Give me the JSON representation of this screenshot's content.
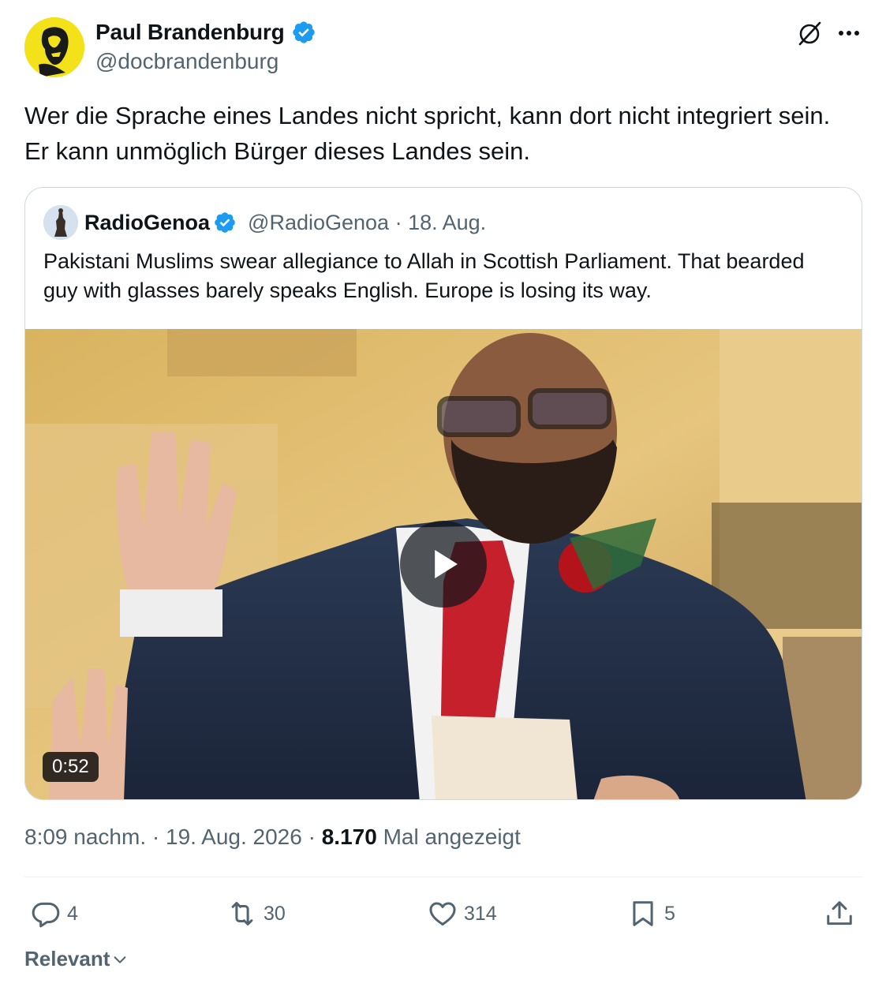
{
  "author": {
    "name": "Paul Brandenburg",
    "handle": "@docbrandenburg",
    "verified": true
  },
  "tweet": {
    "text": "Wer die Sprache eines Landes nicht spricht, kann dort nicht integriert sein. Er kann unmöglich Bürger dieses Landes sein."
  },
  "quoted": {
    "name": "RadioGenoa",
    "handle": "@RadioGenoa",
    "date_sep": " · ",
    "date": "18. Aug.",
    "text": "Pakistani Muslims swear allegiance to Allah in Scottish Parliament. That bearded guy with glasses barely speaks English. Europe is losing its way.",
    "video": {
      "duration": "0:52"
    }
  },
  "meta": {
    "time": "8:09 nachm.",
    "sep1": " · ",
    "date": "19. Aug. 2026",
    "sep2": " · ",
    "views": "8.170",
    "views_label": " Mal angezeigt"
  },
  "actions": {
    "replies": "4",
    "reposts": "30",
    "likes": "314",
    "bookmarks": "5"
  },
  "sort": {
    "label": "Relevant"
  },
  "icons": {
    "verified": "verified-badge-icon",
    "grok": "grok-icon",
    "more": "more-icon",
    "play": "play-icon",
    "reply": "reply-icon",
    "repost": "repost-icon",
    "like": "heart-icon",
    "bookmark": "bookmark-icon",
    "share": "share-icon",
    "chevron": "chevron-down-icon"
  },
  "colors": {
    "text": "#0f1419",
    "secondary": "#536471",
    "verified": "#1d9bf0",
    "border": "#cfd9de",
    "avatar_bg": "#f3e21a"
  }
}
